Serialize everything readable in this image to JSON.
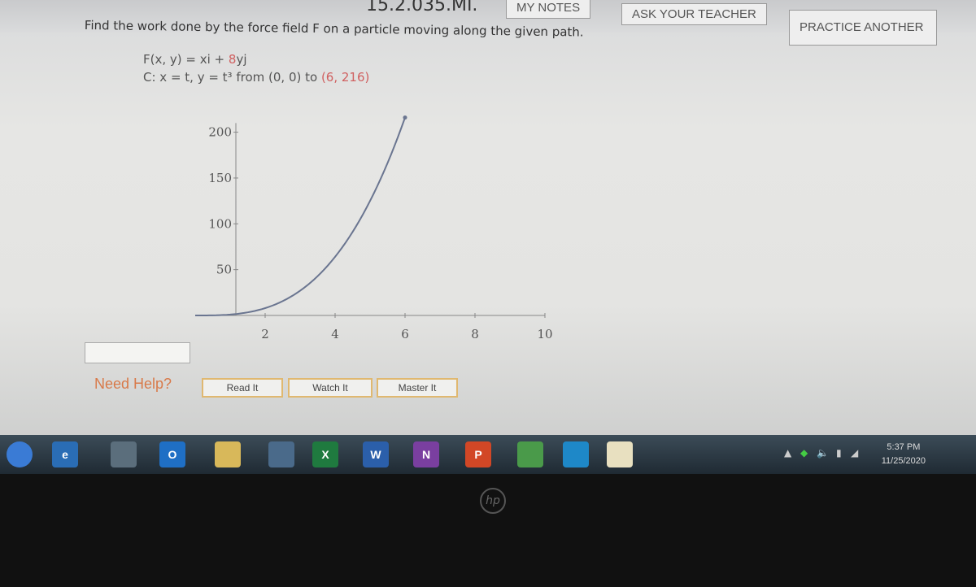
{
  "header": {
    "question_id": "15.2.035.MI.",
    "my_notes": "MY NOTES",
    "ask_teacher": "ASK YOUR TEACHER",
    "practice_another": "PRACTICE ANOTHER"
  },
  "problem": {
    "prompt": "Find the work done by the force field F on a particle moving along the given path.",
    "field_prefix": "F(x, y) = xi + ",
    "field_coef": "8",
    "field_suffix": "yj",
    "path_prefix": "C: x = t, y = t³ from (0, 0) to ",
    "path_end": "(6, 216)"
  },
  "chart_data": {
    "type": "line",
    "title": "",
    "xlabel": "",
    "ylabel": "",
    "xlim": [
      0,
      10
    ],
    "ylim": [
      0,
      216
    ],
    "x_ticks": [
      "2",
      "4",
      "6",
      "8",
      "10"
    ],
    "y_ticks": [
      "50",
      "100",
      "150",
      "200"
    ],
    "function": "y = x^3",
    "x_domain": [
      0,
      6
    ],
    "endpoint": [
      6,
      216
    ],
    "color": "#6a7590",
    "grid": false
  },
  "answer": {
    "value": ""
  },
  "help": {
    "label": "Need Help?",
    "read_it": "Read It",
    "watch_it": "Watch It",
    "master_it": "Master It"
  },
  "taskbar": {
    "apps": [
      {
        "name": "start",
        "glyph": "",
        "color": "#3a7bd5"
      },
      {
        "name": "internet-explorer",
        "glyph": "e",
        "color": "#2a6db5"
      },
      {
        "name": "file",
        "glyph": "",
        "color": "#5b6e7c"
      },
      {
        "name": "outlook",
        "glyph": "O",
        "color": "#1f6fc5"
      },
      {
        "name": "file-explorer",
        "glyph": "",
        "color": "#d8b85a"
      },
      {
        "name": "app",
        "glyph": "",
        "color": "#4a6a8a"
      },
      {
        "name": "excel",
        "glyph": "X",
        "color": "#1f7a3f"
      },
      {
        "name": "word",
        "glyph": "W",
        "color": "#2b5faa"
      },
      {
        "name": "onenote",
        "glyph": "N",
        "color": "#7a3fa0"
      },
      {
        "name": "powerpoint",
        "glyph": "P",
        "color": "#d24726"
      },
      {
        "name": "chrome",
        "glyph": "",
        "color": "#4a9a4a"
      },
      {
        "name": "edge",
        "glyph": "",
        "color": "#1e88c8"
      },
      {
        "name": "notes",
        "glyph": "",
        "color": "#e8e0c0"
      }
    ],
    "time": "5:37 PM",
    "date": "11/25/2020"
  },
  "bezel": {
    "logo": "hp"
  }
}
